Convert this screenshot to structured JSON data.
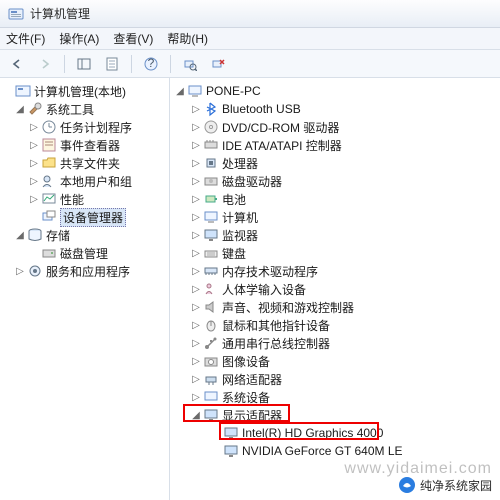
{
  "window": {
    "title": "计算机管理"
  },
  "menu": {
    "file": "文件(F)",
    "action": "操作(A)",
    "view": "查看(V)",
    "help": "帮助(H)"
  },
  "left_tree": {
    "root": "计算机管理(本地)",
    "system_tools": "系统工具",
    "task_scheduler": "任务计划程序",
    "event_viewer": "事件查看器",
    "shared_folders": "共享文件夹",
    "local_users": "本地用户和组",
    "performance": "性能",
    "device_manager": "设备管理器",
    "storage": "存储",
    "disk_mgmt": "磁盘管理",
    "services_apps": "服务和应用程序"
  },
  "right_tree": {
    "root": "PONE-PC",
    "bluetooth": "Bluetooth USB",
    "dvd": "DVD/CD-ROM 驱动器",
    "ide": "IDE ATA/ATAPI 控制器",
    "processor": "处理器",
    "disk_drives": "磁盘驱动器",
    "batteries": "电池",
    "computer": "计算机",
    "monitors": "监视器",
    "keyboards": "键盘",
    "memory_tech": "内存技术驱动程序",
    "hid": "人体学输入设备",
    "sound": "声音、视频和游戏控制器",
    "mice": "鼠标和其他指针设备",
    "usb": "通用串行总线控制器",
    "imaging": "图像设备",
    "network": "网络适配器",
    "system": "系统设备",
    "display": "显示适配器",
    "intel": "Intel(R) HD Graphics 4000",
    "nvidia": "NVIDIA GeForce GT 640M LE"
  },
  "watermark": {
    "url": "www.yidaimei.com",
    "brand": "纯净系统家园"
  },
  "colors": {
    "highlight": "#e00000"
  }
}
